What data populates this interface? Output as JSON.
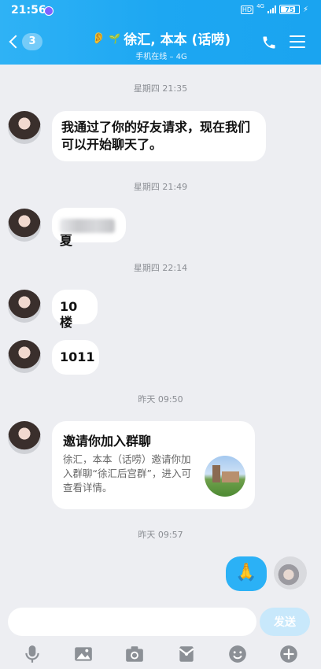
{
  "status_bar": {
    "time": "21:56",
    "network": "4G",
    "hd": "HD",
    "battery": "75",
    "battery_level": 0.75
  },
  "nav": {
    "back_badge": "3",
    "title": "徐汇, 本本 (话唠)",
    "subtitle": "手机在线 – 4G"
  },
  "messages": {
    "ts1": "星期四 21:35",
    "msg1": "我通过了你的好友请求，现在我们可以开始聊天了。",
    "ts2": "星期四 21:49",
    "msg2_suffix": "夏",
    "ts3": "星期四 22:14",
    "msg3": "10楼",
    "msg4": "1011",
    "ts4": "昨天 09:50",
    "card": {
      "title": "邀请你加入群聊",
      "desc": "徐汇，本本（话唠）邀请你加入群聊“徐汇后宫群”，进入可查看详情。"
    },
    "ts5": "昨天 09:57",
    "sent_emoji": "🙏"
  },
  "composer": {
    "placeholder": "",
    "send_label": "发送"
  },
  "colors": {
    "accent": "#1da7f2",
    "bubble_sent": "#2bb1f6",
    "bg": "#edeef2"
  }
}
